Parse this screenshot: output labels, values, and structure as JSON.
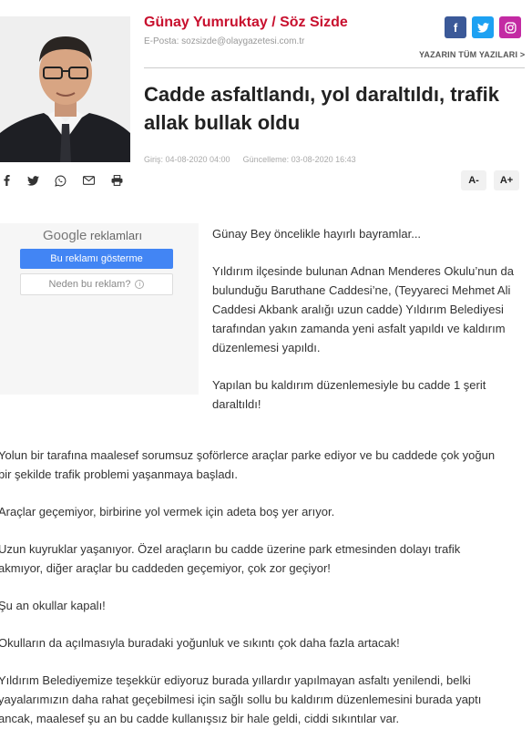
{
  "author": {
    "name": "Günay Yumruktay / Söz Sizde",
    "email": "E-Posta: sozsizde@olaygazetesi.com.tr"
  },
  "social": {
    "facebook_icon": "f",
    "twitter_icon": "twitter-bird",
    "instagram_icon": "instagram-camera",
    "colors": {
      "facebook": "#3b5998",
      "twitter": "#1da1f2",
      "instagram": "#c32aa3"
    }
  },
  "all_posts_label": "YAZARIN TÜM YAZILARI >",
  "article": {
    "title": "Cadde asfaltlandı, yol daraltıldı, trafik allak bullak oldu",
    "created": "Giriş: 04-08-2020 04:00",
    "updated": "Güncelleme: 03-08-2020 16:43"
  },
  "toolbar": {
    "icons": [
      "facebook-icon",
      "twitter-icon",
      "whatsapp-icon",
      "email-icon",
      "print-icon"
    ],
    "font_decrease": "A-",
    "font_increase": "A+"
  },
  "ad": {
    "brand": "Google",
    "title_suffix": " reklamları",
    "primary_button": "Bu reklamı gösterme",
    "secondary_button": "Neden bu reklam?",
    "info_glyph": "i"
  },
  "body": {
    "side": [
      "Günay Bey öncelikle hayırlı bayramlar...",
      "Yıldırım ilçesinde bulunan Adnan Menderes Okulu’nun da bulunduğu Baruthane Caddesi’ne, (Teyyareci Mehmet Ali Caddesi Akbank aralığı uzun cadde) Yıldırım Belediyesi tarafından yakın zamanda yeni asfalt yapıldı ve kaldırım düzenlemesi yapıldı.",
      "Yapılan bu kaldırım düzenlemesiyle bu cadde 1 şerit daraltıldı!"
    ],
    "full": [
      [
        "Yolun bir tarafına maalesef sorumsuz şoförlerce araçlar parke ediyor ve bu caddede çok yoğun",
        "bir şekilde trafik problemi yaşanmaya başladı."
      ],
      [
        "Araçlar geçemiyor, birbirine yol vermek için adeta boş yer arıyor."
      ],
      [
        "Uzun kuyruklar yaşanıyor. Özel araçların bu cadde üzerine park etmesinden dolayı trafik",
        "akmıyor, diğer araçlar bu caddeden geçemiyor, çok zor geçiyor!"
      ],
      [
        "Şu an okullar kapalı!"
      ],
      [
        "Okulların da açılmasıyla buradaki yoğunluk ve sıkıntı çok daha fazla artacak!"
      ],
      [
        "Yıldırım Belediyemize teşekkür ediyoruz burada yıllardır yapılmayan asfaltı yenilendi, belki",
        "yayalarımızın daha rahat geçebilmesi için sağlı sollu bu kaldırım düzenlemesini burada yaptı",
        "ancak, maalesef şu an bu cadde kullanışsız bir hale geldi, ciddi sıkıntılar var."
      ]
    ]
  }
}
